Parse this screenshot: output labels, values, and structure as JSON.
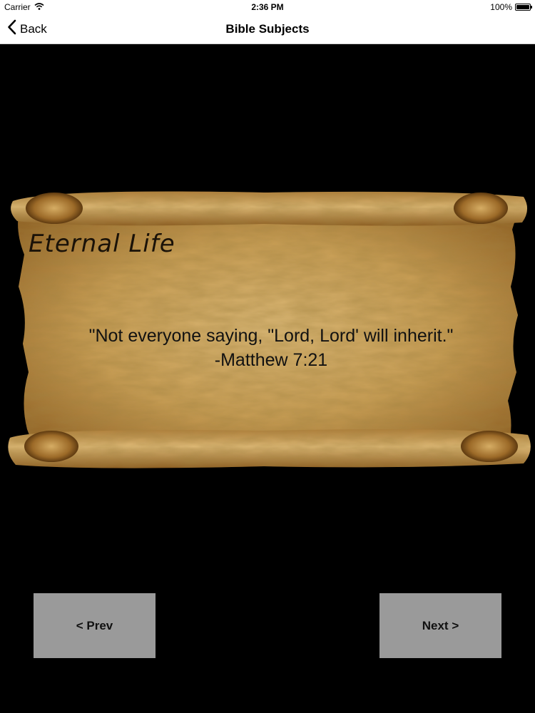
{
  "status_bar": {
    "carrier": "Carrier",
    "time": "2:36 PM",
    "battery": "100%",
    "battery_level": 1.0
  },
  "nav_bar": {
    "back_label": "Back",
    "title": "Bible Subjects"
  },
  "scroll": {
    "heading": "Eternal Life",
    "quote_line1": "\"Not everyone saying, \"Lord, Lord' will inherit.\"",
    "quote_line2": "-Matthew 7:21"
  },
  "buttons": {
    "prev_label": "< Prev",
    "next_label": "Next >"
  },
  "colors": {
    "background": "#000000",
    "parchment": "#c9a25a",
    "button": "#9a9a9a"
  },
  "icons": [
    "wifi-icon",
    "battery-icon",
    "back-chevron-icon"
  ]
}
